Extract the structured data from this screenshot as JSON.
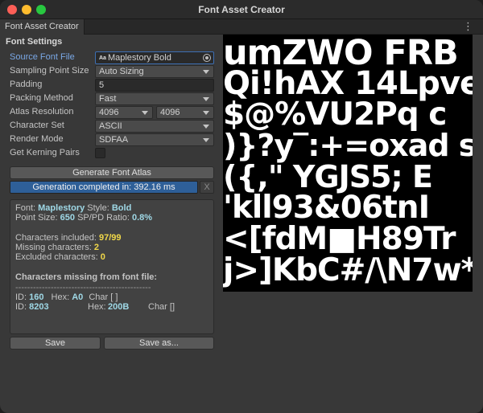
{
  "window": {
    "title": "Font Asset Creator"
  },
  "tab": {
    "label": "Font Asset Creator",
    "menu_icon": "⋮"
  },
  "section_title": "Font Settings",
  "fields": {
    "source_font": {
      "label": "Source Font File",
      "value": "Maplestory Bold",
      "icon": "Aa"
    },
    "sampling": {
      "label": "Sampling Point Size",
      "value": "Auto Sizing"
    },
    "padding": {
      "label": "Padding",
      "value": "5"
    },
    "packing": {
      "label": "Packing Method",
      "value": "Fast"
    },
    "atlas_res": {
      "label": "Atlas Resolution",
      "width": "4096",
      "height": "4096"
    },
    "charset": {
      "label": "Character Set",
      "value": "ASCII"
    },
    "render": {
      "label": "Render Mode",
      "value": "SDFAA"
    },
    "kerning": {
      "label": "Get Kerning Pairs",
      "checked": false
    }
  },
  "buttons": {
    "generate": "Generate Font Atlas",
    "cancel": "X",
    "save": "Save",
    "save_as": "Save as..."
  },
  "progress": {
    "text": "Generation completed in: 392.16 ms",
    "fraction": 1.0
  },
  "info": {
    "font_label": "Font:",
    "font_value": "Maplestory",
    "style_label": "Style:",
    "style_value": "Bold",
    "point_label": "Point Size:",
    "point_value": "650",
    "ratio_label": "SP/PD Ratio:",
    "ratio_value": "0.8%",
    "included_label": "Characters included:",
    "included_value": "97/99",
    "missing_label": "Missing characters:",
    "missing_value": "2",
    "excluded_label": "Excluded characters:",
    "excluded_value": "0",
    "missing_header": "Characters missing from font file:",
    "separator": "----------------------------------------------",
    "rows": [
      {
        "id_label": "ID:",
        "id": "160",
        "hex_label": "Hex:",
        "hex": "A0",
        "char": "Char [ ]"
      },
      {
        "id_label": "ID:",
        "id": "8203",
        "hex_label": "Hex:",
        "hex": "200B",
        "char": "Char []"
      }
    ]
  },
  "atlas_lines": [
    "umZWO FRB",
    "Qi!hAX 14Lpve",
    "$@%VU2Pq c",
    ")}?y‾:+=oxad s",
    "({,\" YGJS5; E",
    "'kll93&06tnI",
    "<[fdM■H89Tr",
    "j>]KbC#/\\N7w*"
  ]
}
